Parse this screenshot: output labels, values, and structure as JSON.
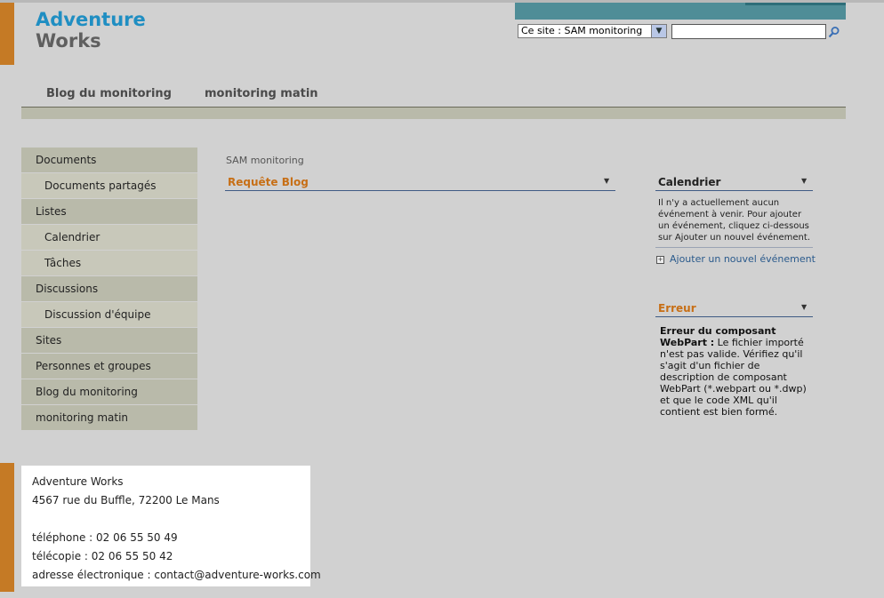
{
  "logo": {
    "line1": "Adventure",
    "line2": "Works"
  },
  "search": {
    "scope": "Ce site : SAM monitoring",
    "value": ""
  },
  "topnav": [
    "Blog du monitoring",
    "monitoring matin"
  ],
  "quicklaunch": [
    {
      "label": "Documents",
      "level": "head"
    },
    {
      "label": "Documents partagés",
      "level": "sub"
    },
    {
      "label": "Listes",
      "level": "head"
    },
    {
      "label": "Calendrier",
      "level": "sub"
    },
    {
      "label": "Tâches",
      "level": "sub"
    },
    {
      "label": "Discussions",
      "level": "head"
    },
    {
      "label": "Discussion d'équipe",
      "level": "sub"
    },
    {
      "label": "Sites",
      "level": "head"
    },
    {
      "label": "Personnes et groupes",
      "level": "head"
    },
    {
      "label": "Blog du monitoring",
      "level": "head"
    },
    {
      "label": "monitoring matin",
      "level": "head"
    }
  ],
  "breadcrumb": "SAM monitoring",
  "webparts": {
    "blog_query": {
      "title": "Requête Blog"
    },
    "calendar": {
      "title": "Calendrier",
      "empty_text": "Il n'y a actuellement aucun événement à venir. Pour ajouter un événement, cliquez ci-dessous sur Ajouter un nouvel événement.",
      "add_link": "Ajouter un nouvel événement"
    },
    "error": {
      "title": "Erreur",
      "heading": "Erreur du composant WebPart :",
      "message": " Le fichier importé n'est pas valide. Vérifiez qu'il s'agit d'un fichier de description de composant WebPart (*.webpart ou *.dwp) et que le code XML qu'il contient est bien formé."
    }
  },
  "footer": {
    "company": "Adventure Works",
    "address": "4567 rue du Buffle, 72200 Le Mans",
    "phone": "téléphone : 02 06 55 50 49",
    "fax": "télécopie : 02 06 55 50 42",
    "email": "adresse électronique : contact@adventure-works.com"
  },
  "colors": {
    "accent_orange": "#c57a25",
    "logo_blue": "#1f8ec2",
    "teal": "#4f8d97",
    "webpart_title": "#c76f16"
  }
}
